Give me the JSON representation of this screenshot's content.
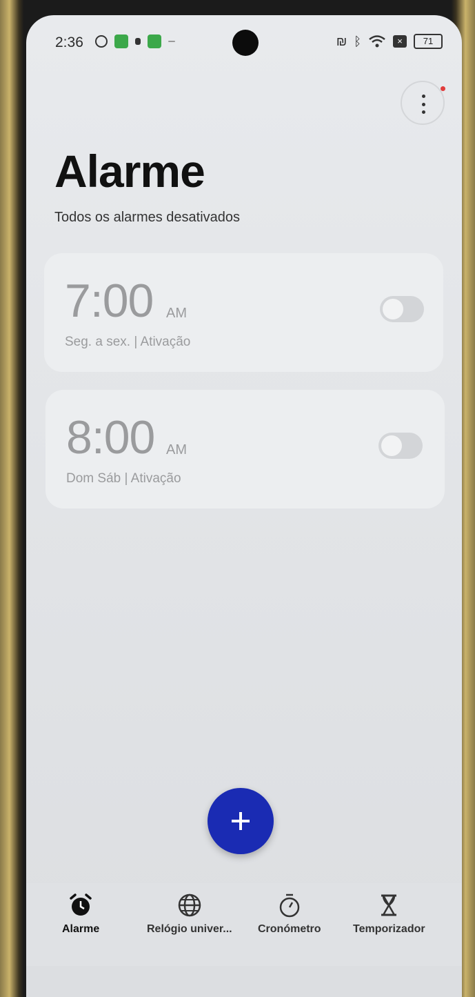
{
  "status_bar": {
    "time": "2:36",
    "battery": "71"
  },
  "header": {
    "title": "Alarme",
    "subtitle": "Todos os alarmes desativados"
  },
  "alarms": [
    {
      "time": "7:00",
      "ampm": "AM",
      "days": "Seg. a sex. | Ativação",
      "enabled": false
    },
    {
      "time": "8:00",
      "ampm": "AM",
      "days": "Dom Sáb | Ativação",
      "enabled": false
    }
  ],
  "nav": {
    "items": [
      {
        "label": "Alarme",
        "icon": "alarm-clock-icon",
        "active": true
      },
      {
        "label": "Relógio univer...",
        "icon": "globe-icon",
        "active": false
      },
      {
        "label": "Cronómetro",
        "icon": "stopwatch-icon",
        "active": false
      },
      {
        "label": "Temporizador",
        "icon": "hourglass-icon",
        "active": false
      }
    ]
  },
  "colors": {
    "fab": "#1a2bb3",
    "notification_dot": "#e03c3c"
  }
}
